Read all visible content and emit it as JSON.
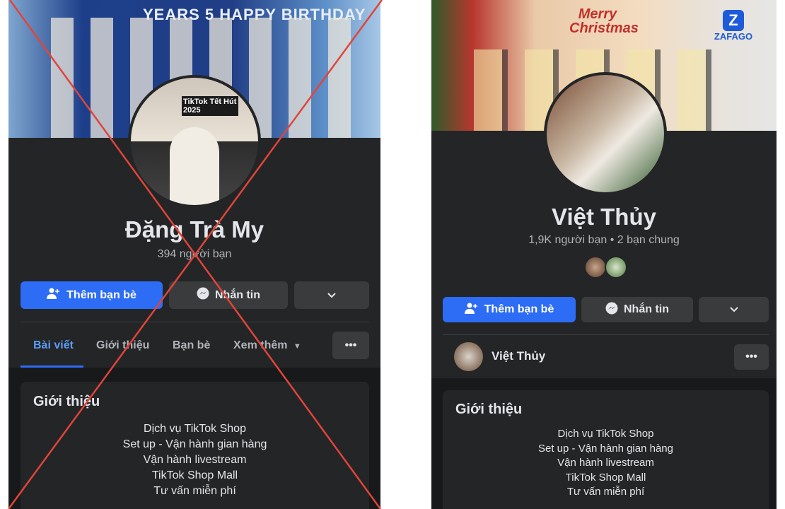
{
  "left_profile": {
    "cover_text": "YEARS 5 HAPPY BIRTHDAY",
    "avatar_text": "TikTok Tết Hút 2025",
    "name": "Đặng Trà My",
    "friends": "394 người bạn",
    "add_friend_label": "Thêm bạn bè",
    "message_label": "Nhắn tin",
    "tabs": [
      "Bài viết",
      "Giới thiệu",
      "Bạn bè",
      "Xem thêm"
    ],
    "active_tab": "Bài viết",
    "intro_title": "Giới thiệu",
    "intro_lines": [
      "Dịch vụ TikTok Shop",
      "Set up - Vận hành gian hàng",
      "Vận hành livestream",
      "TikTok Shop Mall",
      "Tư vấn miễn phí"
    ],
    "crossed_out": true,
    "cross_color": "#e0453a"
  },
  "right_profile": {
    "cover_text": "Merry Christmas",
    "cover_brand": "ZAFAGO",
    "name": "Việt Thủy",
    "friends": "1,9K người bạn • 2 bạn chung",
    "add_friend_label": "Thêm bạn bè",
    "message_label": "Nhắn tin",
    "row_name": "Việt Thủy",
    "intro_title": "Giới thiệu",
    "intro_lines": [
      "Dịch vụ TikTok Shop",
      "Set up - Vận hành gian hàng",
      "Vận hành livestream",
      "TikTok Shop Mall",
      "Tư vấn miễn phí"
    ]
  },
  "colors": {
    "primary": "#2d6cf5",
    "panel": "#242526",
    "background": "#18191a",
    "tab_active": "#5b9cf5"
  }
}
